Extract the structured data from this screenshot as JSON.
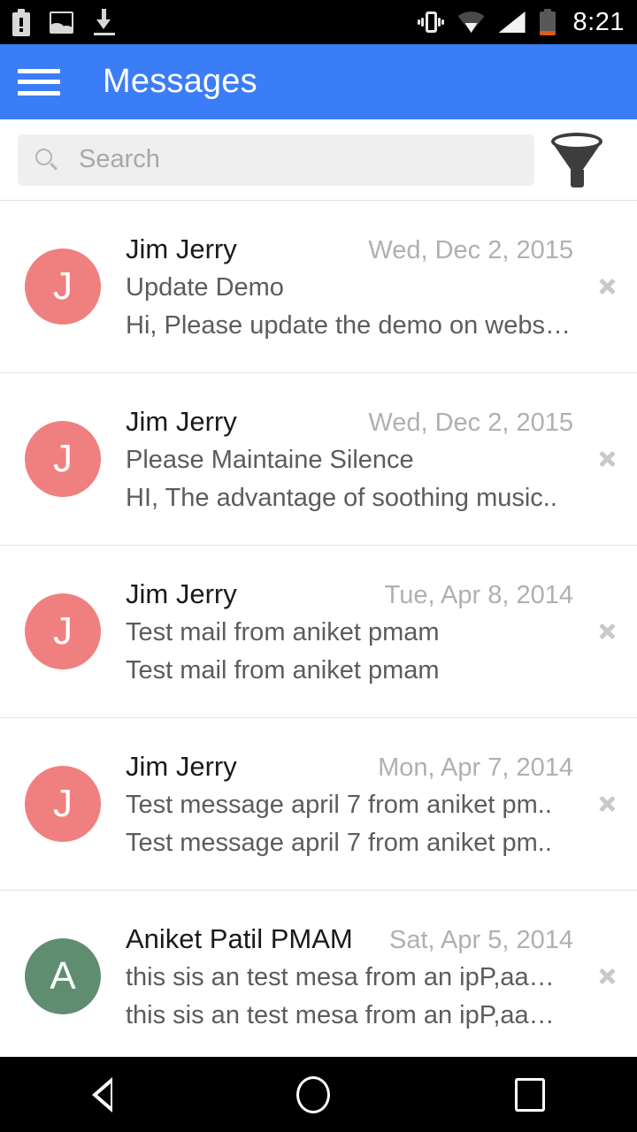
{
  "status_bar": {
    "time": "8:21",
    "left_icons": [
      "battery-alert-icon",
      "image-icon",
      "download-icon"
    ],
    "right_icons": [
      "vibrate-icon",
      "wifi-icon",
      "signal-icon",
      "battery-low-icon"
    ]
  },
  "app_bar": {
    "title": "Messages",
    "menu_icon": "hamburger-menu-icon",
    "background_color": "#3b7df6"
  },
  "search": {
    "placeholder": "Search",
    "value": "",
    "icon": "search-icon",
    "filter_icon": "filter-funnel-icon"
  },
  "messages": [
    {
      "avatar_letter": "J",
      "avatar_color": "#f08080",
      "sender": "Jim Jerry",
      "date": "Wed, Dec 2, 2015",
      "subject": "Update Demo",
      "preview": "Hi, Please update the demo on webs…",
      "chevron": "chevron-right-icon"
    },
    {
      "avatar_letter": "J",
      "avatar_color": "#f08080",
      "sender": "Jim Jerry",
      "date": "Wed, Dec 2, 2015",
      "subject": "Please Maintaine Silence",
      "preview": "HI, The advantage of soothing music..",
      "chevron": "chevron-right-icon"
    },
    {
      "avatar_letter": "J",
      "avatar_color": "#f08080",
      "sender": "Jim Jerry",
      "date": "Tue, Apr 8, 2014",
      "subject": "Test mail from aniket pmam",
      "preview": "Test mail from aniket pmam",
      "chevron": "chevron-right-icon"
    },
    {
      "avatar_letter": "J",
      "avatar_color": "#f08080",
      "sender": "Jim Jerry",
      "date": "Mon, Apr 7, 2014",
      "subject": "Test message april 7 from aniket pm..",
      "preview": "Test message april 7 from aniket pm..",
      "chevron": "chevron-right-icon"
    },
    {
      "avatar_letter": "A",
      "avatar_color": "#5f8d70",
      "sender": "Aniket Patil PMAM",
      "date": "Sat, Apr 5, 2014",
      "subject": "this sis an test mesa from an ipP,aa…",
      "preview": "this sis an test mesa from an ipP,aa…",
      "chevron": "chevron-right-icon"
    }
  ],
  "nav_bar": {
    "back": "back-triangle-icon",
    "home": "home-circle-icon",
    "recents": "recents-square-icon"
  }
}
